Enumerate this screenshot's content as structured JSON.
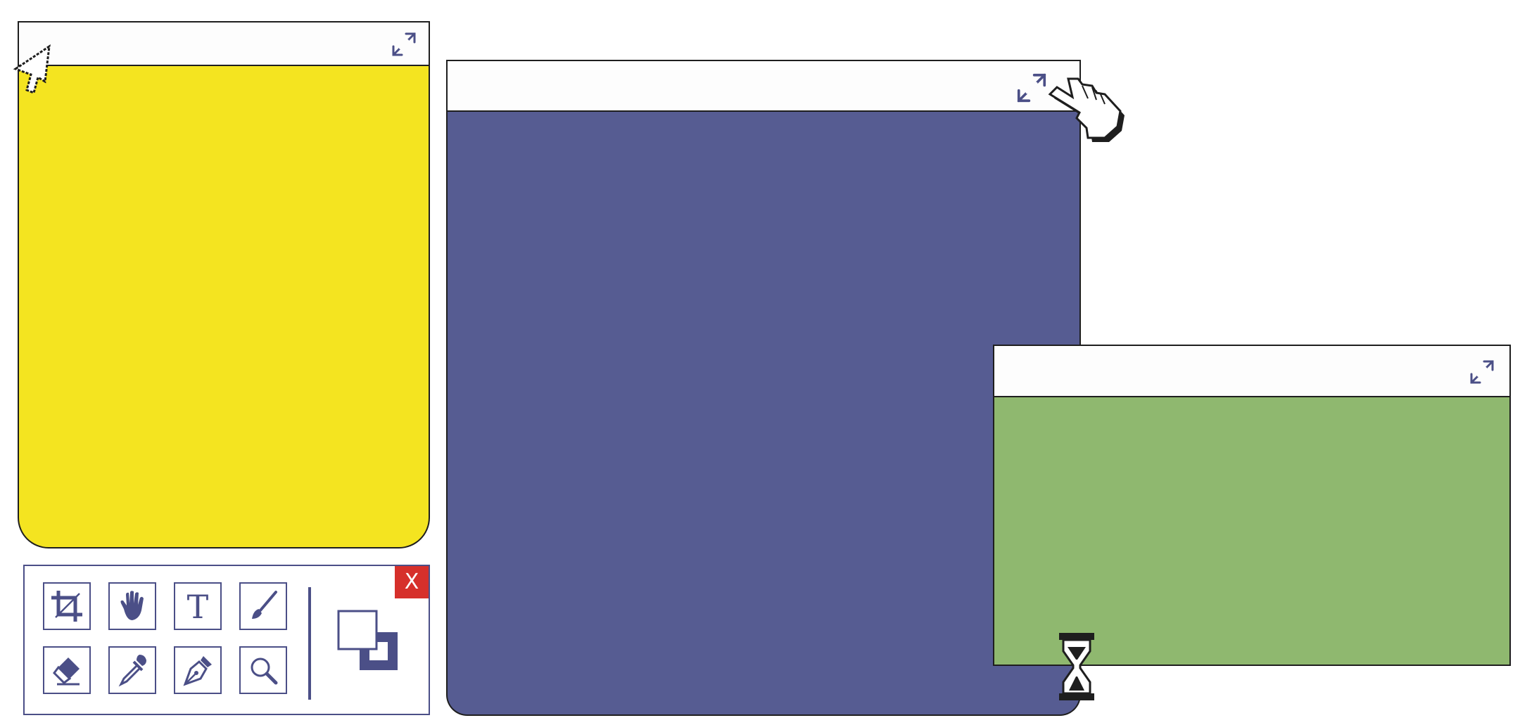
{
  "colors": {
    "yellow": "#f4e420",
    "blue": "#565c92",
    "green": "#8fb86f",
    "accent": "#4b4f87",
    "close": "#d6302b"
  },
  "windows": [
    {
      "id": "yellow",
      "color": "yellow",
      "icon": "maximize-icon"
    },
    {
      "id": "blue",
      "color": "blue",
      "icon": "maximize-icon"
    },
    {
      "id": "green",
      "color": "green",
      "icon": "maximize-icon"
    }
  ],
  "toolbox": {
    "close_label": "X",
    "tools": [
      {
        "name": "crop-tool",
        "icon": "crop-icon"
      },
      {
        "name": "hand-tool",
        "icon": "hand-icon"
      },
      {
        "name": "text-tool",
        "icon": "text-icon",
        "label": "T"
      },
      {
        "name": "brush-tool",
        "icon": "brush-icon"
      },
      {
        "name": "eraser-tool",
        "icon": "eraser-icon"
      },
      {
        "name": "eyedropper-tool",
        "icon": "eyedropper-icon"
      },
      {
        "name": "pen-tool",
        "icon": "pen-nib-icon"
      },
      {
        "name": "zoom-tool",
        "icon": "magnifier-icon"
      }
    ],
    "color_swap_icon": "color-swap-icon"
  },
  "cursors": [
    "arrow-cursor-icon",
    "hand-pointer-cursor-icon",
    "hourglass-cursor-icon"
  ]
}
